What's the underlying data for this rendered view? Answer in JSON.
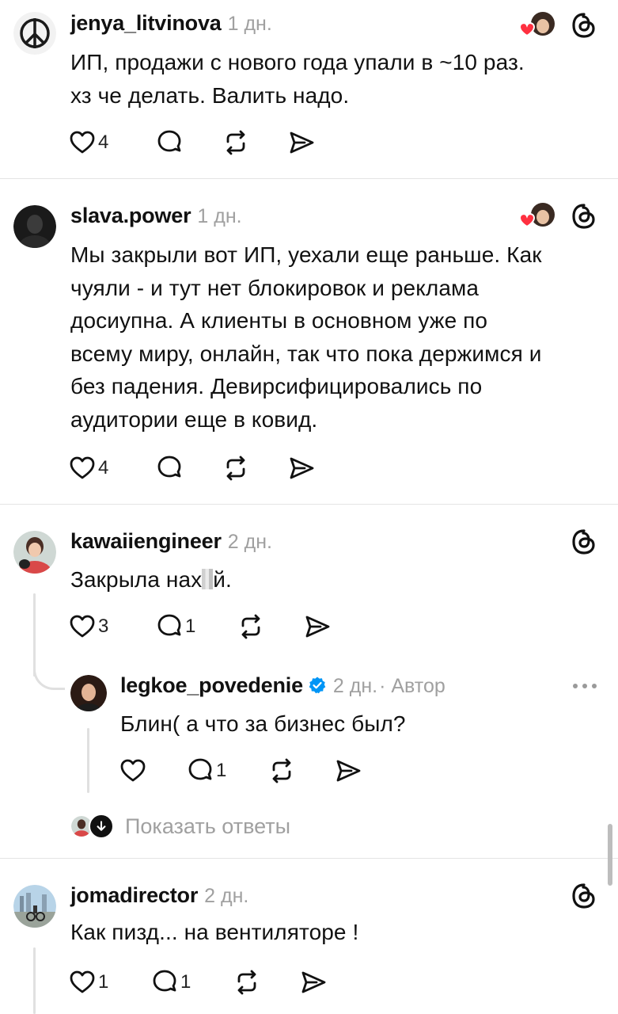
{
  "posts": [
    {
      "username": "jenya_litvinova",
      "time": "1 дн.",
      "text_lines": [
        "ИП, продажи с нового года упали в ~10 раз.",
        "хз че делать. Валить надо."
      ],
      "likes": "4",
      "replies": "",
      "liked_by_author": true
    },
    {
      "username": "slava.power",
      "time": "1 дн.",
      "text_lines": [
        "Мы закрыли вот ИП, уехали еще раньше. Как",
        "чуяли - и тут нет блокировок и реклама",
        "досиупна. А клиенты в основном уже по",
        "всему миру, онлайн, так что пока держимся и",
        "без падения. Девирсифицировались по",
        "аудитории еще в ковид."
      ],
      "likes": "4",
      "replies": "",
      "liked_by_author": true
    },
    {
      "username": "kawaiiengineer",
      "time": "2 дн.",
      "text_before": "Закрыла нах",
      "text_after": "й.",
      "likes": "3",
      "replies": "1"
    },
    {
      "username": "legkoe_povedenie",
      "time": "2 дн.",
      "author_label": "· Автор",
      "text": "Блин( а что за бизнес был?",
      "likes": "",
      "replies": "1"
    },
    {
      "username": "jomadirector",
      "time": "2 дн.",
      "text": "Как пизд... на вентиляторе !",
      "likes": "1",
      "replies": "1"
    }
  ],
  "show_replies_label": "Показать ответы",
  "icons": {
    "like": "heart-outline-icon",
    "reply": "comment-bubble-icon",
    "repost": "repost-arrows-icon",
    "share": "send-icon",
    "threads": "threads-logo-icon",
    "more": "more-dots-icon",
    "verified": "verified-badge-icon"
  },
  "colors": {
    "heart_red": "#ff3040",
    "verified_blue": "#0095f6",
    "muted": "#a0a0a0"
  }
}
